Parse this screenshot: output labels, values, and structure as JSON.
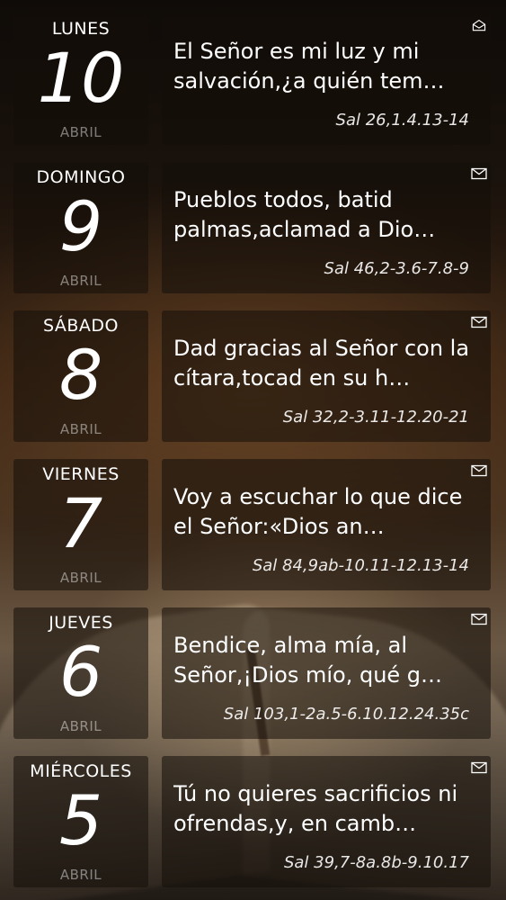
{
  "days": [
    {
      "weekday": "LUNES",
      "day": "10",
      "month": "ABRIL",
      "verse": "El Señor es mi luz y mi salvación,¿a quién tem…",
      "reference": "Sal 26,1.4.13-14",
      "icon": "mail-open-icon"
    },
    {
      "weekday": "DOMINGO",
      "day": "9",
      "month": "ABRIL",
      "verse": "Pueblos todos, batid palmas,aclamad a Dio…",
      "reference": "Sal 46,2-3.6-7.8-9",
      "icon": "mail-icon"
    },
    {
      "weekday": "SÁBADO",
      "day": "8",
      "month": "ABRIL",
      "verse": "Dad gracias al Señor con la cítara,tocad en su h…",
      "reference": "Sal 32,2-3.11-12.20-21",
      "icon": "mail-icon"
    },
    {
      "weekday": "VIERNES",
      "day": "7",
      "month": "ABRIL",
      "verse": "Voy a escuchar lo que dice el Señor:«Dios an…",
      "reference": "Sal 84,9ab-10.11-12.13-14",
      "icon": "mail-icon"
    },
    {
      "weekday": "JUEVES",
      "day": "6",
      "month": "ABRIL",
      "verse": "Bendice, alma mía, al Señor,¡Dios mío, qué g…",
      "reference": "Sal 103,1-2a.5-6.10.12.24.35c",
      "icon": "mail-icon"
    },
    {
      "weekday": "MIÉRCOLES",
      "day": "5",
      "month": "ABRIL",
      "verse": "Tú no quieres sacrificios ni ofrendas,y, en camb…",
      "reference": "Sal 39,7-8a.8b-9.10.17",
      "icon": "mail-icon"
    }
  ]
}
